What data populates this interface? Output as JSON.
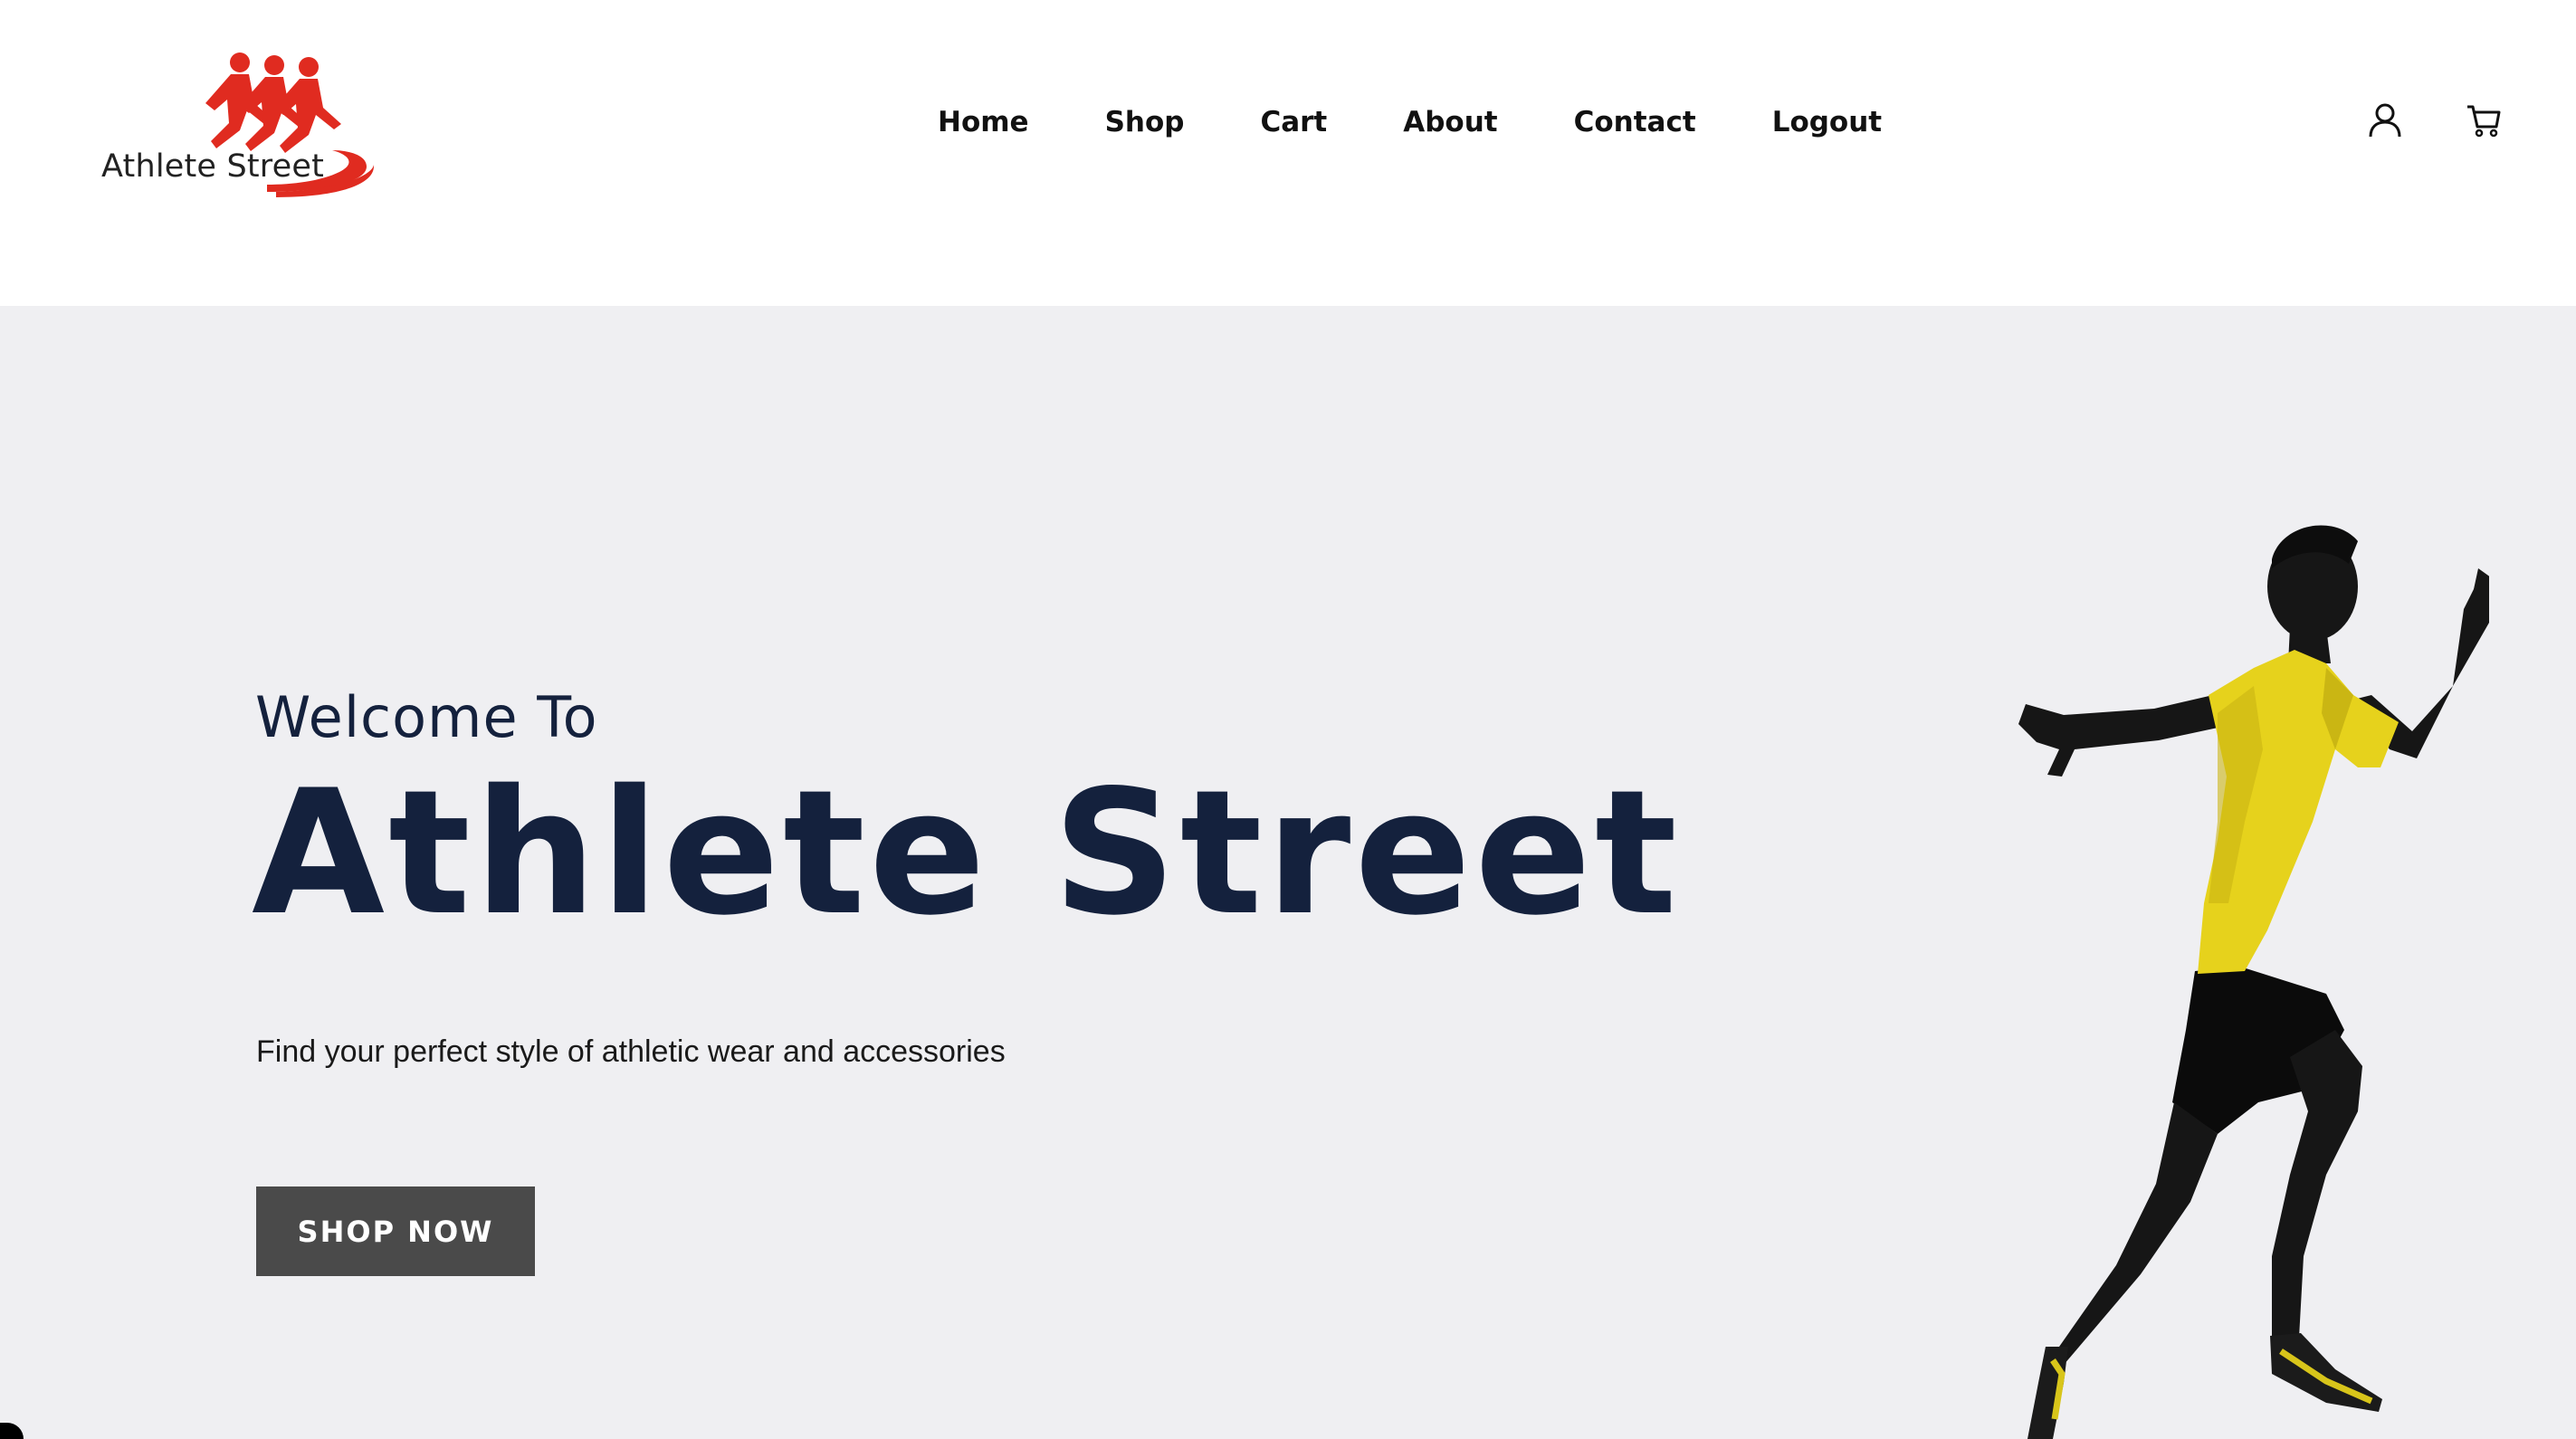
{
  "logo": {
    "text": "Athlete Street",
    "icon": "runners-logo",
    "accent": "#e02b20"
  },
  "nav": {
    "items": [
      {
        "label": "Home"
      },
      {
        "label": "Shop"
      },
      {
        "label": "Cart"
      },
      {
        "label": "About"
      },
      {
        "label": "Contact"
      },
      {
        "label": "Logout"
      }
    ]
  },
  "header_icons": {
    "account": "user-icon",
    "cart": "cart-icon"
  },
  "hero": {
    "welcome": "Welcome To",
    "title": "Athlete Street",
    "subtitle": "Find your perfect style of athletic wear and accessories",
    "cta_label": "SHOP NOW",
    "image": "sprinter-silhouette"
  },
  "colors": {
    "hero_bg": "#efeff2",
    "heading": "#14213d",
    "button_bg": "#4a4a4a",
    "shirt": "#e6d21c"
  }
}
